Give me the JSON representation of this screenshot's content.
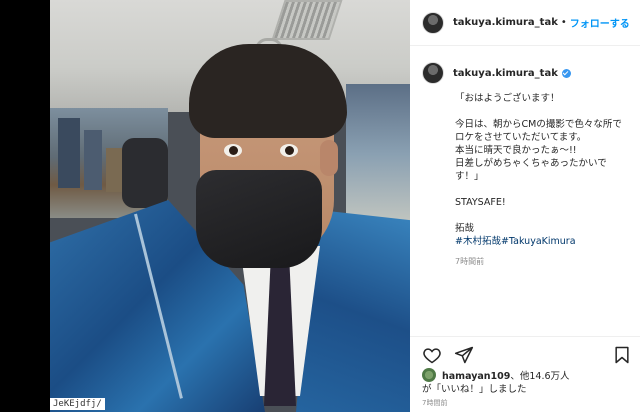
{
  "header": {
    "username": "takuya.kimura_tak",
    "separator": "•",
    "follow_label": "フォローする"
  },
  "post": {
    "username": "takuya.kimura_tak",
    "caption_lines": [
      "「おはようございます！",
      "",
      "今日は、朝からCMの撮影で色々な所で",
      "ロケをさせていただいてます。",
      "本当に晴天で良かったぁ〜!!",
      "日差しがめちゃくちゃあったかいで",
      "す！」",
      "",
      "STAYSAFE!",
      "",
      "拓哉"
    ],
    "hashtags": "#木村拓哉#TakuyaKimura",
    "posted_ago": "7時間前"
  },
  "likes": {
    "liker": "hamayan109",
    "others": "、他14.6万人",
    "suffix": "が「いいね！」しました",
    "time": "7時間前"
  },
  "photo": {
    "watermark": "JeKEjdfj/"
  },
  "icons": [
    "heart-icon",
    "share-icon",
    "bookmark-icon",
    "verified-badge-icon"
  ],
  "colors": {
    "follow": "#0095f6",
    "hashtag": "#00376b",
    "verified": "#3897f0"
  }
}
